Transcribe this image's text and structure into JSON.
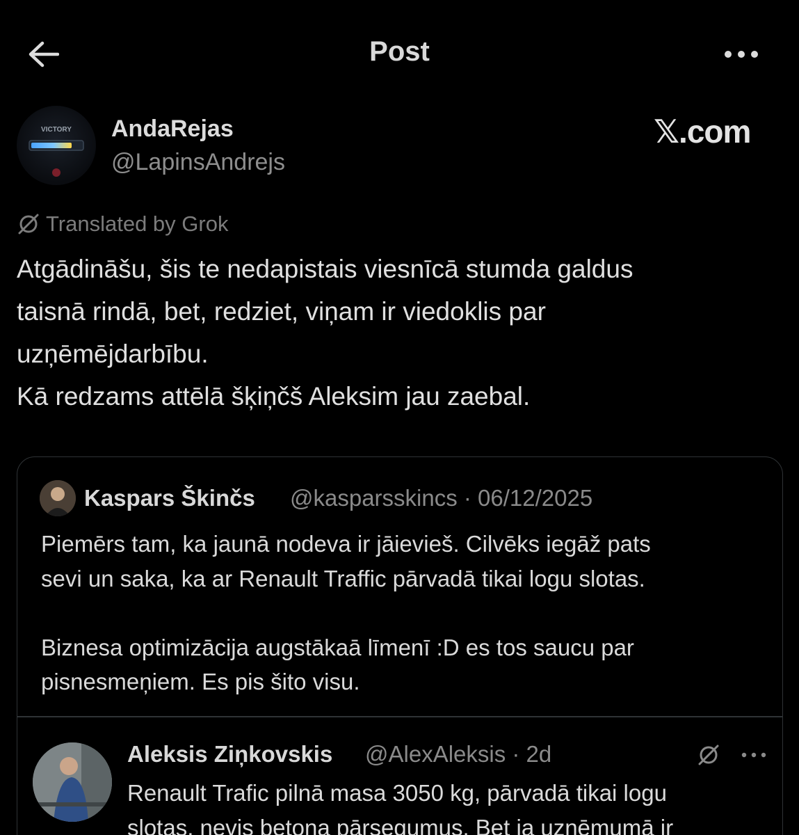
{
  "header": {
    "title": "Post",
    "back_icon": "arrow-left-icon",
    "more_icon": "more-horizontal-icon"
  },
  "author": {
    "display_name": "AndaRejas",
    "handle": "@LapinsAndrejs",
    "avatar_text": "VICTORY",
    "watermark": "𝕏.com"
  },
  "translation": {
    "label": "Translated by Grok",
    "icon": "grok-icon"
  },
  "post": {
    "lines": [
      "Atgādināšu, šis te nedapistais viesnīcā stumda galdus",
      "taisnā rindā, bet, redziet, viņam ir viedoklis par",
      "uzņēmējdarbību.",
      "Kā redzams attēlā šķiņčš Aleksim jau zaebal."
    ]
  },
  "quote": {
    "display_name": "Kaspars Škinčs",
    "handle_date": "@kasparsskincs · 06/12/2025",
    "lines": [
      "Piemērs tam, ka jaunā nodeva ir jāievieš. Cilvēks iegāž pats",
      "sevi un saka, ka ar Renault Traffic pārvadā tikai logu slotas.",
      "",
      "Biznesa optimizācija augstākaā līmenī :D es tos saucu par",
      "pisnesmeņiem. Es pis šito visu."
    ],
    "nested": {
      "display_name": "Aleksis Ziņkovskis",
      "handle_date": "@AlexAleksis · 2d",
      "lines": [
        "Renault Trafic pilnā masa 3050 kg, pārvadā tikai logu",
        "slotas, nevis betona pārsegumus. Bet ja uzņēmumā ir"
      ]
    }
  },
  "colors": {
    "background": "#000000",
    "text": "#e7e9ea",
    "secondary": "#8a8a8a",
    "border": "#2f3336"
  }
}
